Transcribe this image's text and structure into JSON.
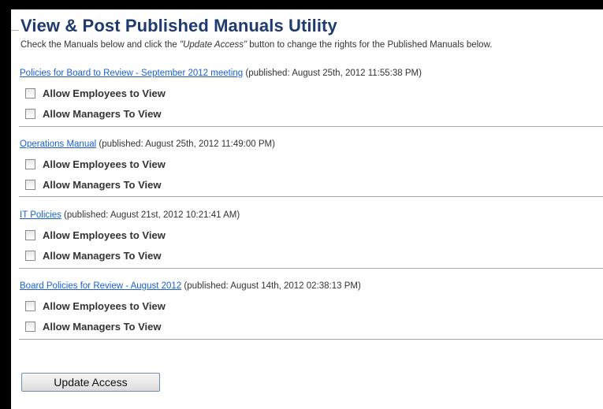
{
  "page": {
    "title": "View & Post Published Manuals Utility",
    "instructions_before": "Check the Manuals below and click the ",
    "instructions_em": "\"Update Access\"",
    "instructions_after": " button to change the rights for the Published Manuals below."
  },
  "manuals": [
    {
      "title": "Policies for Board to Review - September 2012 meeting",
      "published": "(published: August 25th, 2012 11:55:38 PM)",
      "employees_label": "Allow Employees to View",
      "managers_label": "Allow Managers To View"
    },
    {
      "title": "Operations Manual",
      "published": "(published: August 25th, 2012 11:49:00 PM)",
      "employees_label": "Allow Employees to View",
      "managers_label": "Allow Managers To View"
    },
    {
      "title": "IT Policies",
      "published": "(published: August 21st, 2012 10:21:41 AM)",
      "employees_label": "Allow Employees to View",
      "managers_label": "Allow Managers To View"
    },
    {
      "title": "Board Policies for Review - August 2012",
      "published": "(published: August 14th, 2012 02:38:13 PM)",
      "employees_label": "Allow Employees to View",
      "managers_label": "Allow Managers To View"
    }
  ],
  "update_button": "Update Access"
}
